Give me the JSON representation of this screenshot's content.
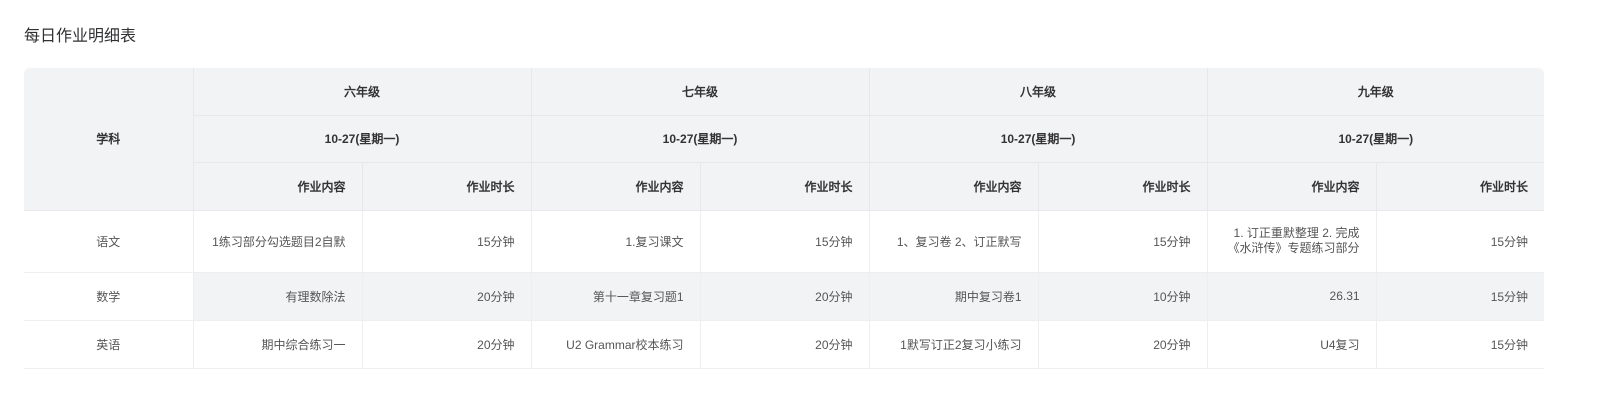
{
  "page_title": "每日作业明细表",
  "subject_header": "学科",
  "grades": [
    {
      "name": "六年级",
      "date": "10-27(星期一)"
    },
    {
      "name": "七年级",
      "date": "10-27(星期一)"
    },
    {
      "name": "八年级",
      "date": "10-27(星期一)"
    },
    {
      "name": "九年级",
      "date": "10-27(星期一)"
    }
  ],
  "sub_headers": {
    "content": "作业内容",
    "duration": "作业时长"
  },
  "rows": [
    {
      "subject": "语文",
      "cells": [
        {
          "content": "1练习部分勾选题目2自默",
          "duration": "15分钟"
        },
        {
          "content": "1.复习课文",
          "duration": "15分钟"
        },
        {
          "content": "1、复习卷 2、订正默写",
          "duration": "15分钟"
        },
        {
          "content_line1": "1. 订正重默整理 2. 完成",
          "content_line2": "《水浒传》专题练习部分",
          "duration": "15分钟"
        }
      ]
    },
    {
      "subject": "数学",
      "cells": [
        {
          "content": "有理数除法",
          "duration": "20分钟"
        },
        {
          "content": "第十一章复习题1",
          "duration": "20分钟"
        },
        {
          "content": "期中复习卷1",
          "duration": "10分钟"
        },
        {
          "content": "26.31",
          "duration": "15分钟"
        }
      ]
    },
    {
      "subject": "英语",
      "cells": [
        {
          "content": "期中综合练习一",
          "duration": "20分钟"
        },
        {
          "content": "U2 Grammar校本练习",
          "duration": "20分钟"
        },
        {
          "content": "1默写订正2复习小练习",
          "duration": "20分钟"
        },
        {
          "content": "U4复习",
          "duration": "15分钟"
        }
      ]
    }
  ]
}
